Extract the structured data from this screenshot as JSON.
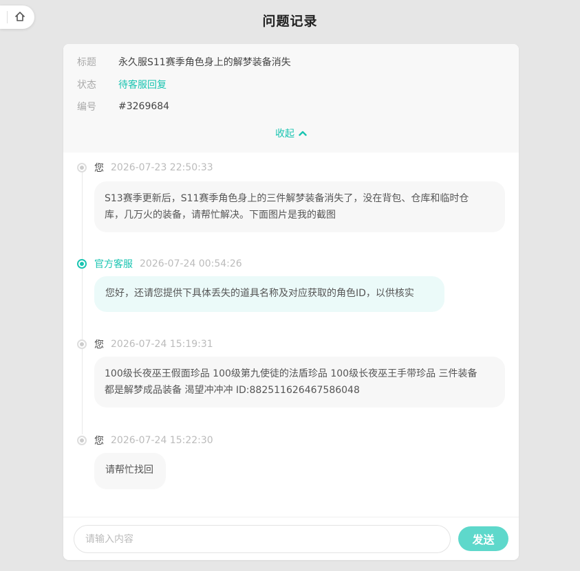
{
  "page": {
    "title": "问题记录"
  },
  "ticket": {
    "title_label": "标题",
    "title_value": "永久服S11赛季角色身上的解梦装备消失",
    "status_label": "状态",
    "status_value": "待客服回复",
    "id_label": "编号",
    "id_value": "#3269684",
    "collapse_label": "收起"
  },
  "messages": [
    {
      "author": "您",
      "time": "2026-07-23 22:50:33",
      "text_lines": [
        "S13赛季更新后，S11赛季角色身上的三件解梦装备消失了，没在背包、仓库和临时仓",
        "库，几万火的装备，请帮忙解决。下面图片是我的截图"
      ]
    },
    {
      "author": "官方客服",
      "time": "2026-07-24 00:54:26",
      "text_lines": [
        "您好，还请您提供下具体丢失的道具名称及对应获取的角色ID，以供核实"
      ]
    },
    {
      "author": "您",
      "time": "2026-07-24 15:19:31",
      "text_lines": [
        "100级长夜巫王假面珍品 100级第九使徒的法盾珍品 100级长夜巫王手带珍品 三件装备",
        "都是解梦成品装备 渴望冲冲冲 ID:882511626467586048"
      ]
    },
    {
      "author": "您",
      "time": "2026-07-24 15:22:30",
      "text_lines": [
        "请帮忙找回"
      ]
    }
  ],
  "composer": {
    "placeholder": "请输入内容",
    "send_label": "发送"
  },
  "colors": {
    "accent": "#19c4b1",
    "send_button": "#5ed8cb"
  },
  "icons": {
    "home": "home-icon",
    "collapse": "chevron-up-icon"
  }
}
